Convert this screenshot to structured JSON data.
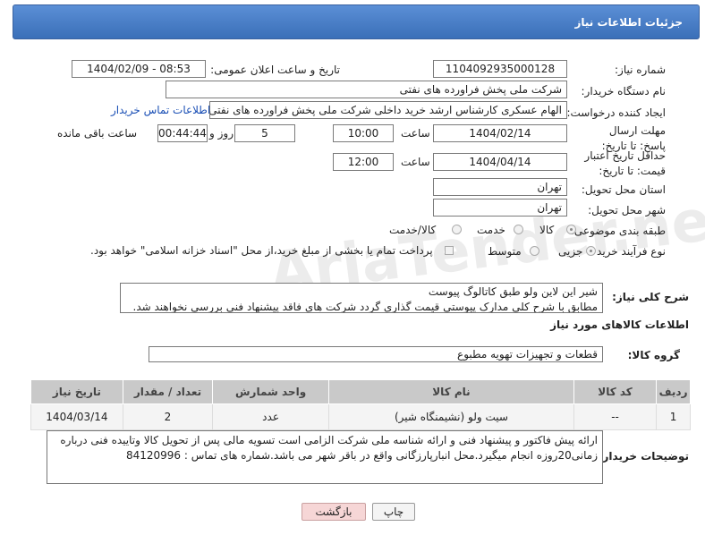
{
  "header": {
    "title": "جزئیات اطلاعات نیاز"
  },
  "watermark": "AriaTender.net",
  "form": {
    "need_number_label": "شماره نیاز:",
    "need_number": "1104092935000128",
    "announce_label": "تاریخ و ساعت اعلان عمومی:",
    "announce_value": "1404/02/09 - 08:53",
    "buyer_org_label": "نام دستگاه خریدار:",
    "buyer_org": "شرکت ملی پخش فراورده های نفتی",
    "creator_label": "ایجاد کننده درخواست:",
    "creator": "الهام عسکری کارشناس ارشد خرید داخلی شرکت ملی پخش فراورده های نفتی",
    "contact_link": "اطلاعات تماس خریدار",
    "deadline_label": "مهلت ارسال پاسخ: تا تاریخ:",
    "deadline_date": "1404/02/14",
    "time_label": "ساعت",
    "deadline_time": "10:00",
    "days_value": "5",
    "days_label": "روز و",
    "remaining_time": "00:44:44",
    "remaining_label": "ساعت باقی مانده",
    "validity_label": "حداقل تاریخ اعتبار قیمت: تا تاریخ:",
    "validity_date": "1404/04/14",
    "validity_time": "12:00",
    "province_label": "استان محل تحویل:",
    "province": "تهران",
    "city_label": "شهر محل تحویل:",
    "city": "تهران",
    "category_label": "طبقه بندی موضوعی:",
    "category_options": [
      "کالا",
      "خدمت",
      "کالا/خدمت"
    ],
    "category_selected": 0,
    "process_label": "نوع فرآیند خرید :",
    "process_options": [
      "جزیی",
      "متوسط"
    ],
    "process_selected": 0,
    "payment_note": "پرداخت تمام یا بخشی از مبلغ خرید،از محل \"اسناد خزانه اسلامی\" خواهد بود."
  },
  "description": {
    "label": "شرح کلی نیاز:",
    "line1": "شیر این لاین ولو طبق کاتالوگ پیوست",
    "line2": "مطابق با شرح کلی مدارک پیوستی قیمت گذاری گردد شرکت های فاقد پیشنهاد فنی بررسی نخواهند شد."
  },
  "goods_info": {
    "title": "اطلاعات کالاهای مورد نیاز",
    "group_label": "گروه کالا:",
    "group_value": "قطعات و تجهیزات تهویه مطبوع"
  },
  "table": {
    "headers": [
      "ردیف",
      "کد کالا",
      "نام کالا",
      "واحد شمارش",
      "تعداد / مقدار",
      "تاریخ نیاز"
    ],
    "rows": [
      [
        "1",
        "--",
        "سیت ولو (نشیمنگاه شیر)",
        "عدد",
        "2",
        "1404/03/14"
      ]
    ]
  },
  "buyer_notes": {
    "label": "توضیحات خریدار:",
    "line1": "ارائه پیش فاکتور و پیشنهاد فنی و ارائه شناسه ملی شرکت الزامی است تسویه مالی پس از تحویل کالا وتاییده فنی درباره",
    "line2": "زمانی20روزه انجام میگیرد.محل انبارپارزگانی واقع در باقر شهر می باشد.شماره های تماس : 84120996"
  },
  "buttons": {
    "print": "چاپ",
    "back": "بازگشت"
  },
  "colors": {
    "header": "#3a6fb8",
    "link": "#1a4fb5",
    "back_button": "#f6d6d6"
  }
}
